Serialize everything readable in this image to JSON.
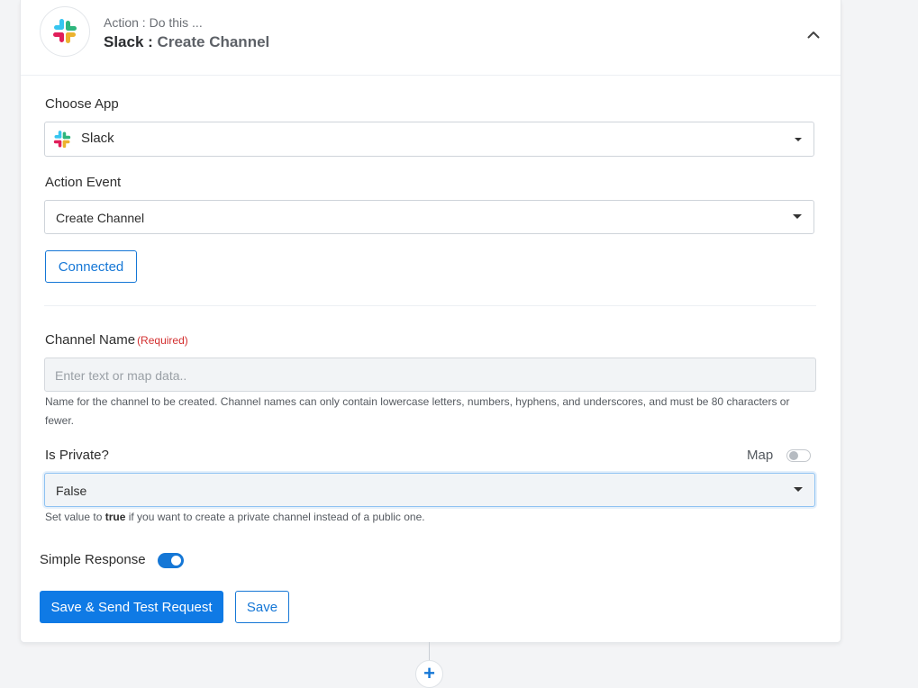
{
  "header": {
    "subtitle": "Action : Do this ...",
    "app_name": "Slack",
    "separator": " : ",
    "event_name": "Create Channel",
    "logo_icon": "slack-logo-icon",
    "collapse_icon": "chevron-up-icon"
  },
  "choose_app": {
    "label": "Choose App",
    "value": "Slack",
    "icon": "slack-logo-icon"
  },
  "action_event": {
    "label": "Action Event",
    "value": "Create Channel"
  },
  "connection": {
    "button_label": "Connected"
  },
  "channel_name": {
    "label": "Channel Name",
    "required_label": "(Required)",
    "placeholder": "Enter text or map data..",
    "help_line1": "Name for the channel to be created. Channel names can only contain lowercase letters, numbers, hyphens, and underscores, and must be 80 characters or",
    "help_line2": "fewer."
  },
  "is_private": {
    "label": "Is Private?",
    "map_label": "Map",
    "map_enabled": false,
    "value": "False",
    "help_prefix": "Set value to ",
    "help_bold": "true",
    "help_suffix": " if you want to create a private channel instead of a public one."
  },
  "simple_response": {
    "label": "Simple Response",
    "enabled": true
  },
  "buttons": {
    "save_and_test": "Save & Send Test Request",
    "save": "Save"
  },
  "add_step": {
    "label": "+"
  },
  "colors": {
    "accent": "#1577d6",
    "primary_button": "#0f7ae5",
    "required": "#d32f2f"
  }
}
